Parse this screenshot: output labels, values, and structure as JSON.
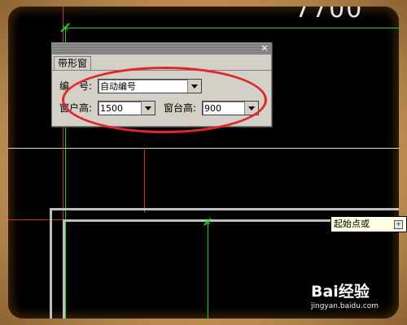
{
  "drawing": {
    "dimension_text": "7700"
  },
  "dialog": {
    "close_symbol": "✕",
    "tab_label": "带形窗",
    "number_label": "编　号:",
    "number_value": "自动编号",
    "window_height_label": "窗户高:",
    "window_height_value": "1500",
    "sill_height_label": "窗台高:",
    "sill_height_value": "900"
  },
  "tooltip": {
    "text": "起始点或"
  },
  "watermark": {
    "brand": "Bai经验",
    "url": "jingyan.baidu.com"
  },
  "colors": {
    "canvas": "#000000",
    "highlight_ellipse": "#e0282b",
    "guide_green": "#1fd21f",
    "guide_red": "#c0392b"
  }
}
